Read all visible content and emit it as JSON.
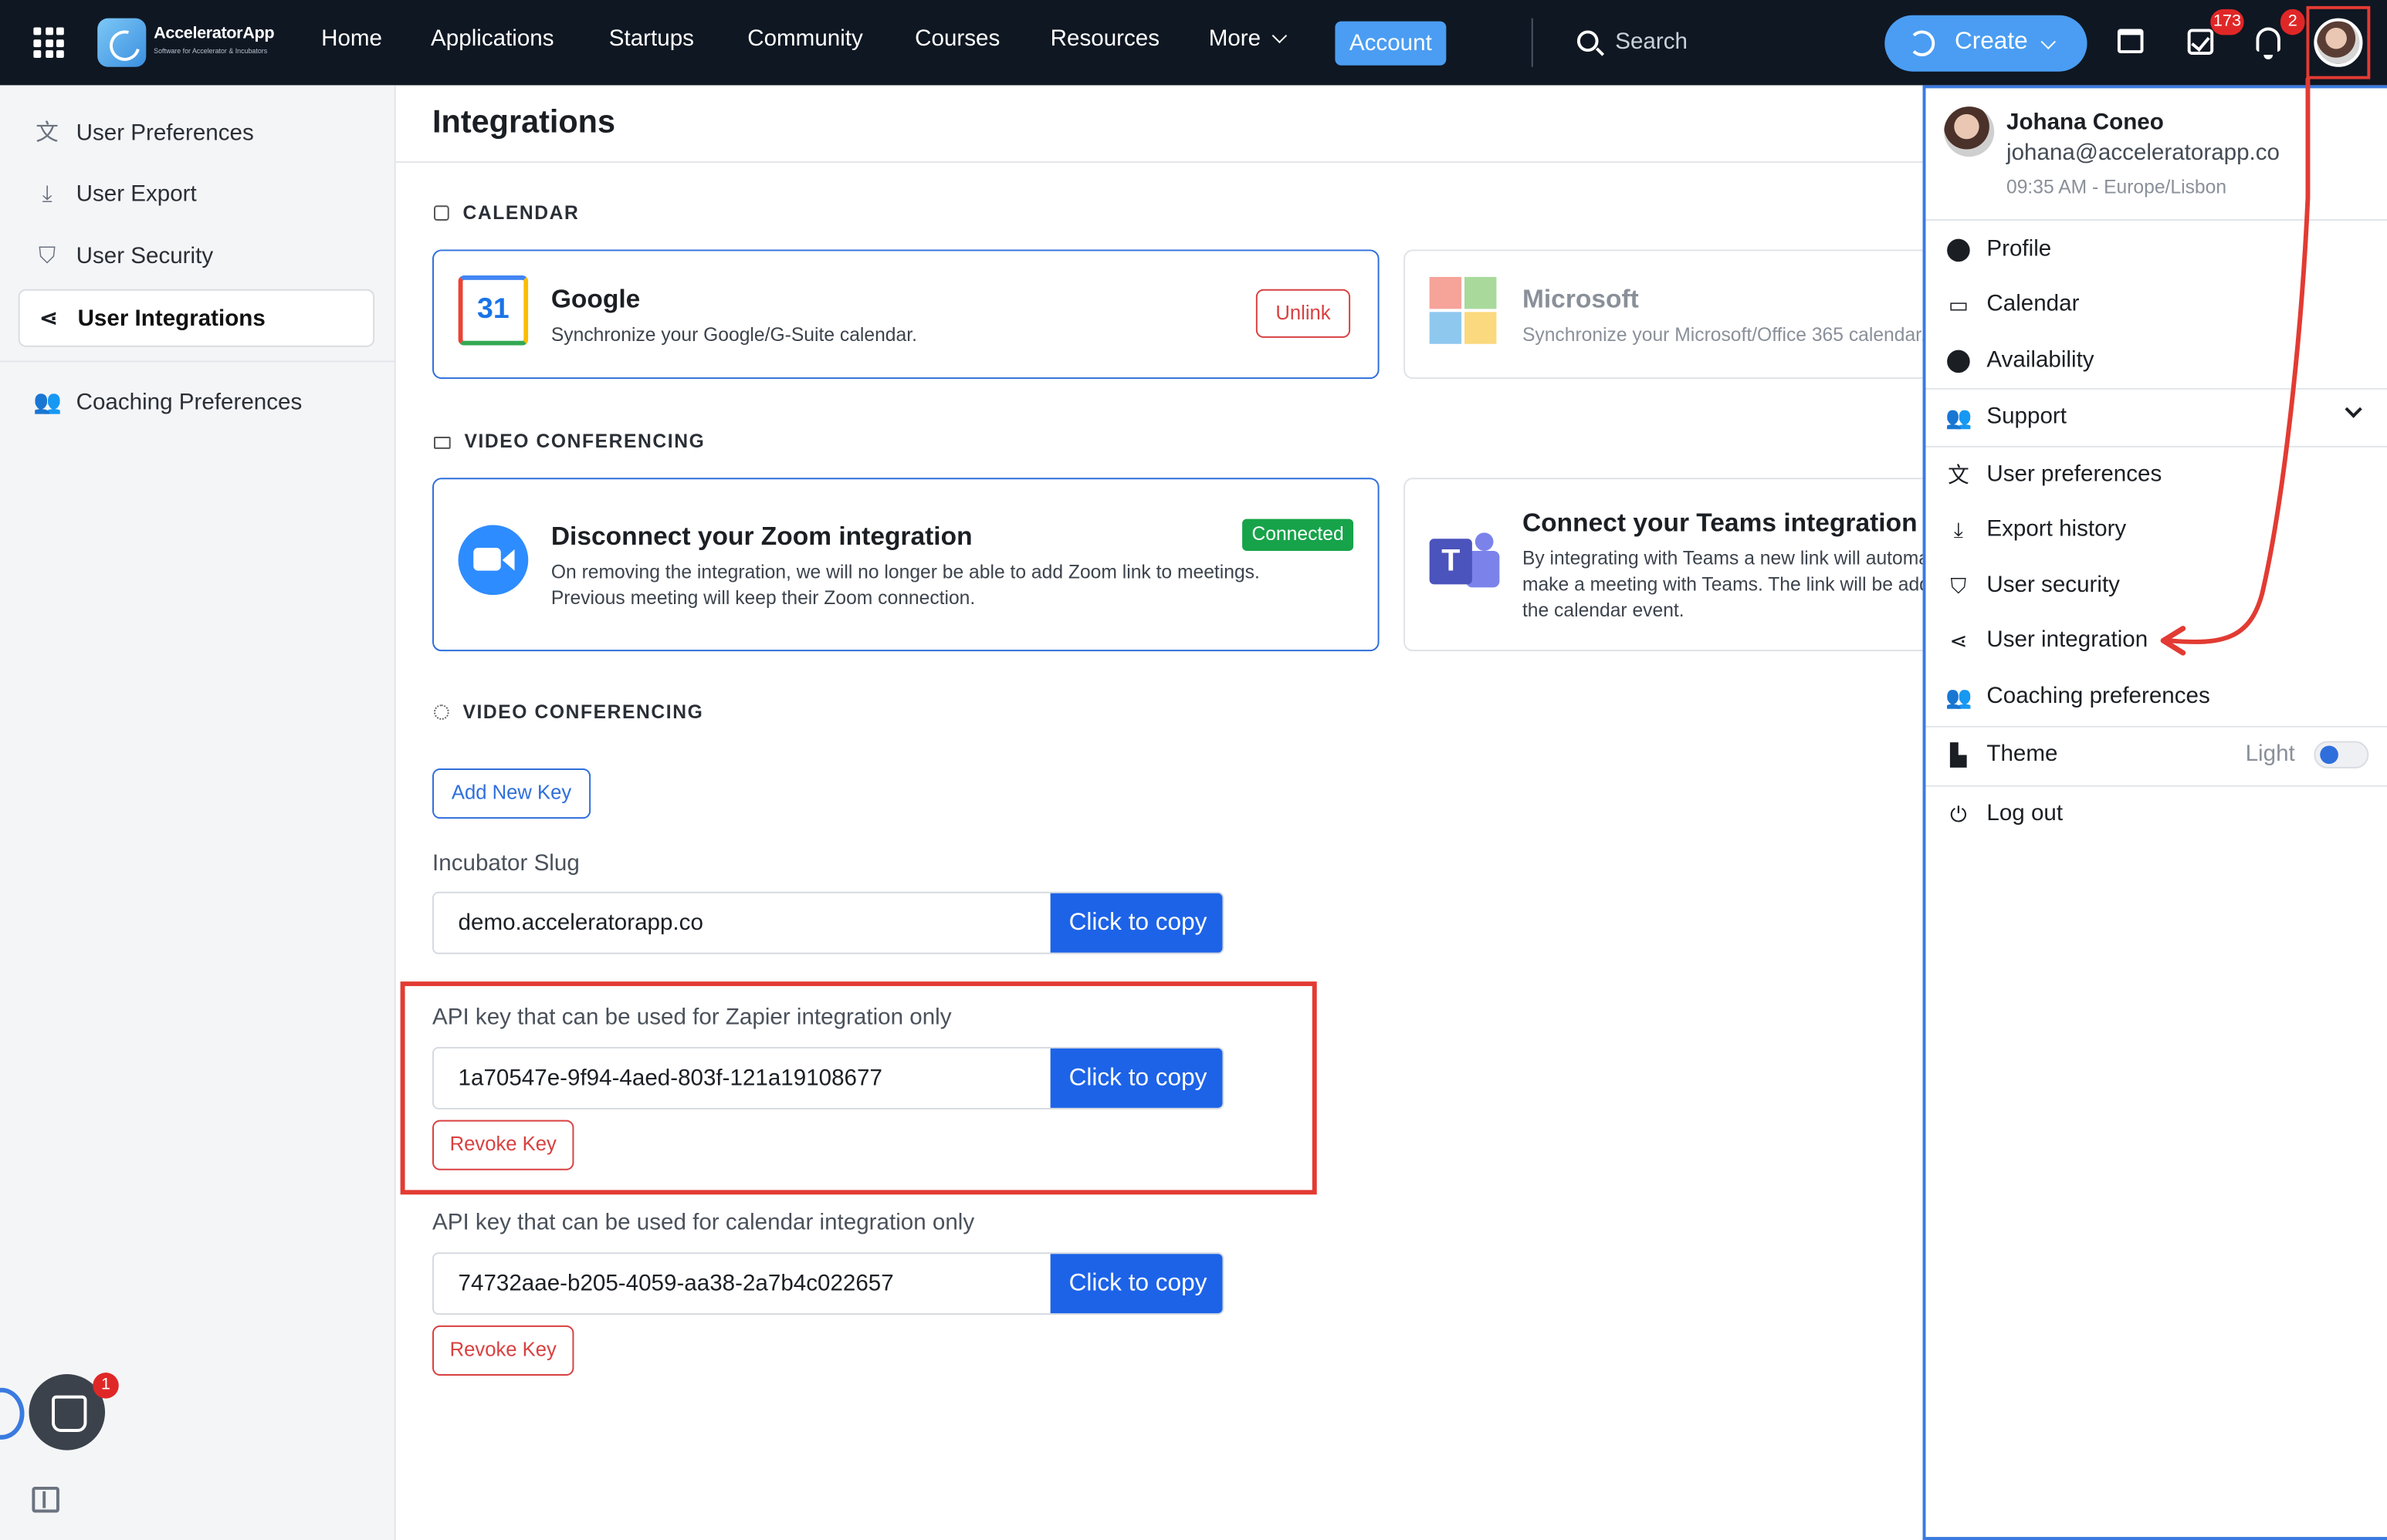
{
  "app": {
    "brand": "AcceleratorApp",
    "brand_tagline": "Software for Accelerator & Incubators"
  },
  "nav": {
    "links": [
      "Home",
      "Applications",
      "Startups",
      "Community",
      "Courses",
      "Resources",
      "More"
    ],
    "account": "Account",
    "search_placeholder": "Search",
    "create": "Create",
    "tasks_badge": "173",
    "notifications_badge": "2"
  },
  "sidebar": {
    "items": [
      {
        "label": "User Preferences",
        "icon": "translate-icon"
      },
      {
        "label": "User Export",
        "icon": "download-icon"
      },
      {
        "label": "User Security",
        "icon": "shield-icon"
      },
      {
        "label": "User Integrations",
        "icon": "share-node-icon",
        "active": true
      },
      {
        "label": "Coaching Preferences",
        "icon": "people-icon"
      }
    ],
    "chat_badge": "1"
  },
  "main": {
    "title": "Integrations",
    "sections": {
      "calendar": "CALENDAR",
      "video": "VIDEO CONFERENCING",
      "keys": "VIDEO CONFERENCING"
    },
    "google": {
      "icon_text": "31",
      "title": "Google",
      "desc": "Synchronize your Google/G-Suite calendar.",
      "action": "Unlink"
    },
    "microsoft": {
      "title": "Microsoft",
      "desc": "Synchronize your Microsoft/Office 365 calendar."
    },
    "zoom": {
      "title": "Disconnect your Zoom integration",
      "status": "Connected",
      "desc1": "On removing the integration, we will no longer be able to add Zoom link to meetings.",
      "desc2": "Previous meeting will keep their Zoom connection."
    },
    "teams": {
      "icon_text": "T",
      "title": "Connect your Teams integration",
      "desc1": "By integrating with Teams a new link will automatically",
      "desc2": "make a meeting with Teams. The link will be added to",
      "desc3": "the calendar event."
    },
    "add_key": "Add New Key",
    "slug": {
      "label": "Incubator Slug",
      "value": "demo.acceleratorapp.co",
      "copy": "Click to copy"
    },
    "zapier": {
      "label": "API key that can be used for Zapier integration only",
      "value": "1a70547e-9f94-4aed-803f-121a19108677",
      "copy": "Click to copy",
      "revoke": "Revoke Key"
    },
    "calendar_key": {
      "label": "API key that can be used for calendar integration only",
      "value": "74732aae-b205-4059-aa38-2a7b4c022657",
      "copy": "Click to copy",
      "revoke": "Revoke Key"
    }
  },
  "dropdown": {
    "name": "Johana Coneo",
    "email": "johana@acceleratorapp.co",
    "timezone": "09:35 AM - Europe/Lisbon",
    "items": {
      "profile": "Profile",
      "calendar": "Calendar",
      "availability": "Availability",
      "support": "Support",
      "user_preferences": "User preferences",
      "export_history": "Export history",
      "user_security": "User security",
      "user_integration": "User integration",
      "coaching_preferences": "Coaching preferences",
      "theme": "Theme",
      "theme_value": "Light",
      "logout": "Log out"
    }
  },
  "colors": {
    "nav_bg": "#0f1722",
    "accent": "#4a9df2",
    "primary": "#1d63e8",
    "danger": "#d94040",
    "success": "#17a34a",
    "annotation": "#e23b33"
  }
}
